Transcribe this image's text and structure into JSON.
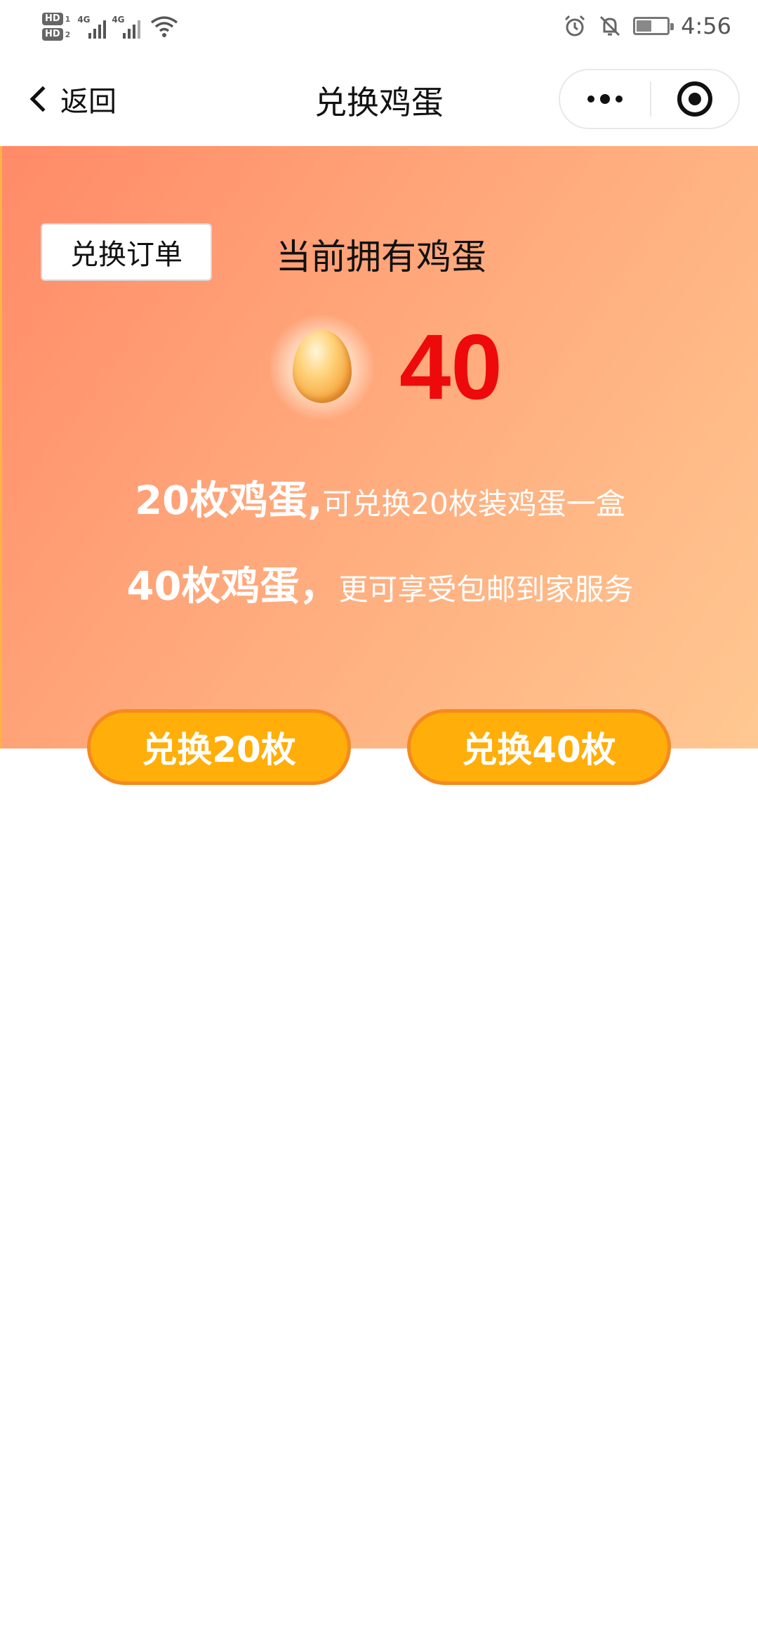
{
  "status_bar": {
    "hd1": "HD",
    "hd1_num": "1",
    "hd2": "HD",
    "hd2_num": "2",
    "network1": "4G",
    "network2": "4G",
    "time": "4:56",
    "battery_level": 0.45,
    "icons": [
      "alarm-icon",
      "mute-bell-icon",
      "battery-icon",
      "wifi-icon"
    ]
  },
  "nav": {
    "back_label": "返回",
    "title": "兑换鸡蛋"
  },
  "hero": {
    "order_button": "兑换订单",
    "owned_label": "当前拥有鸡蛋",
    "egg_count": "40",
    "line1_bold": "20枚鸡蛋,",
    "line1_text": "可兑换20枚装鸡蛋一盒",
    "line2_bold": "40枚鸡蛋，",
    "line2_text": "更可享受包邮到家服务"
  },
  "actions": {
    "exchange_20": "兑换20枚",
    "exchange_40": "兑换40枚"
  },
  "colors": {
    "count_red": "#ee0a0a",
    "button_orange": "#ffae0a",
    "button_border": "#f58a1f"
  }
}
